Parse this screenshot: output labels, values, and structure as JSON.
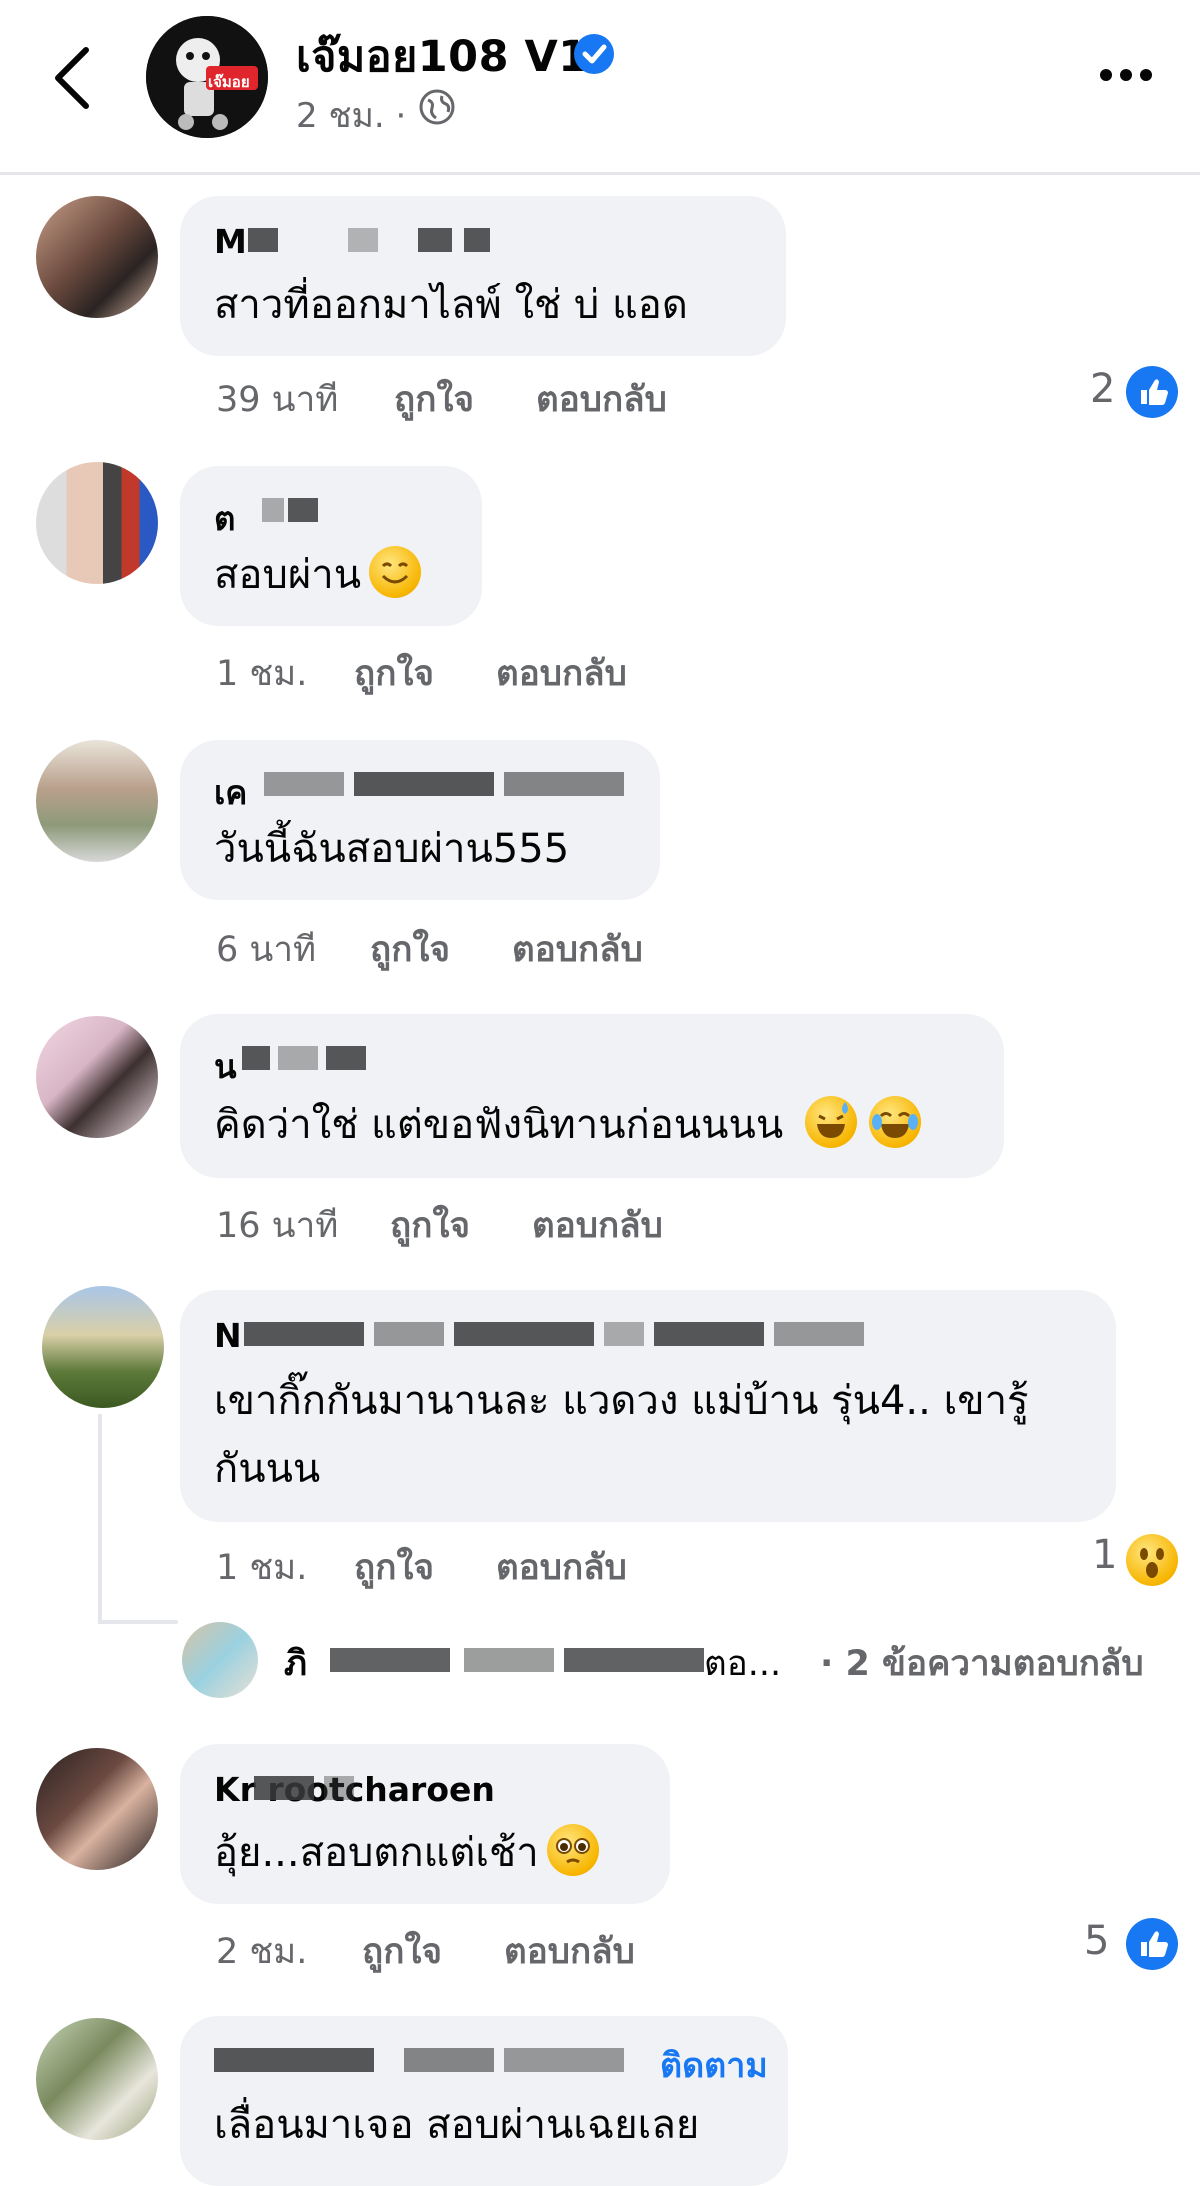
{
  "header": {
    "page_name": "เจ๊มอย108 V1",
    "time": "2 ชม. ·",
    "avatar_text": "เจ๊มอย"
  },
  "actions": {
    "like": "ถูกใจ",
    "reply": "ตอบกลับ"
  },
  "comments": [
    {
      "author": "M",
      "text": "สาวที่ออกมาไลพ์ ใช่  บ่ แอด",
      "time": "39 นาที",
      "reactions": "2"
    },
    {
      "author": "ต",
      "text": "สอบผ่าน",
      "time": "1 ชม."
    },
    {
      "author": "เค",
      "text": "วันนี้ฉันสอบผ่าน555",
      "time": "6 นาที"
    },
    {
      "author": "น",
      "text": "คิดว่าใช่ แต่ขอฟังนิทานก่อนนนน",
      "time": "16 นาที"
    },
    {
      "author": "N",
      "text_line1": "เขากิ๊กกันมานานละ แวดวง แม่บ้าน รุ่น4.. เขารู้",
      "text_line2": "กันนน",
      "time": "1 ชม.",
      "reactions": "1"
    },
    {
      "author": "Kr    rootcharoen",
      "text": "อุ้ย...สอบตกแต่เช้า",
      "time": "2 ชม.",
      "reactions": "5"
    },
    {
      "author": "",
      "follow": "ติดตาม",
      "text": "เลื่อนมาเจอ สอบผ่านเฉยเลย"
    }
  ],
  "reply_preview": {
    "author_start": "ภิ",
    "truncated": "ตอ...",
    "count_text": "· 2 ข้อความตอบกลับ"
  },
  "colors": {
    "like_blue": "#1877f2",
    "bubble": "#f0f2f5",
    "meta_gray": "#65676b"
  }
}
